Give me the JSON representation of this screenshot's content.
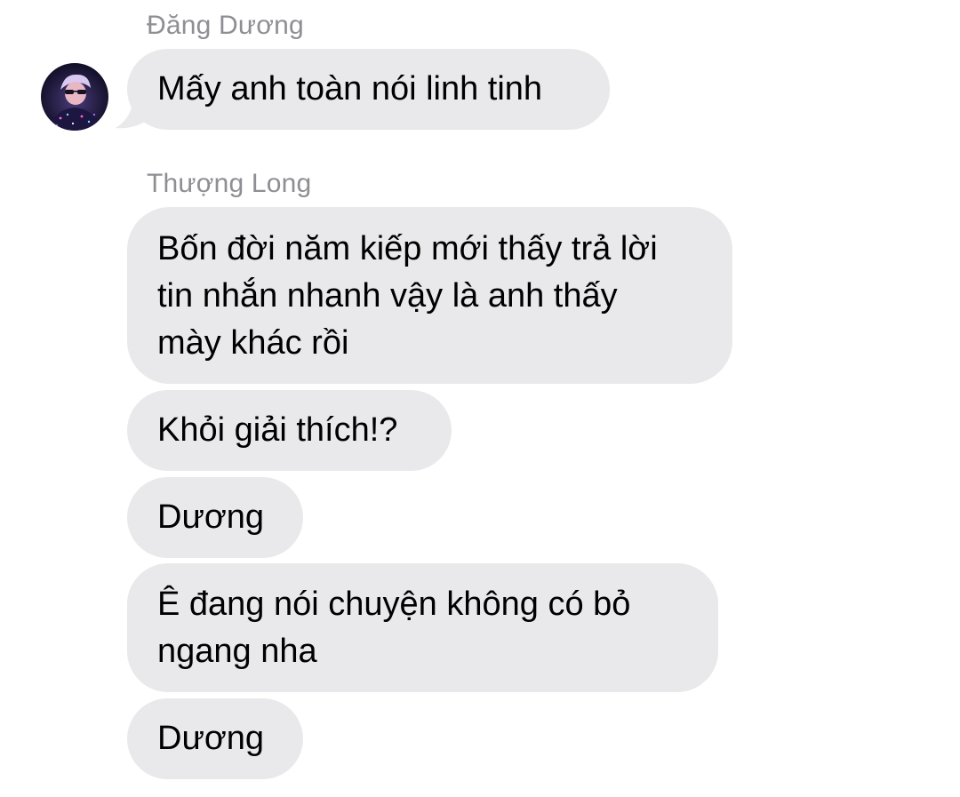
{
  "conversation": {
    "groups": [
      {
        "sender": "Đăng Dương",
        "messages": [
          {
            "lines": [
              "Mấy anh toàn nói linh tinh"
            ]
          }
        ]
      },
      {
        "sender": "Thượng Long",
        "messages": [
          {
            "lines": [
              "Bốn đời năm kiếp mới thấy trả lời",
              "tin nhắn nhanh vậy là anh thấy",
              "mày khác rồi"
            ]
          },
          {
            "lines": [
              "Khỏi giải thích!?"
            ]
          },
          {
            "lines": [
              "Dương"
            ]
          },
          {
            "lines": [
              "Ê đang nói chuyện không có bỏ",
              "ngang nha"
            ]
          },
          {
            "lines": [
              "Dương"
            ]
          }
        ]
      }
    ]
  },
  "colors": {
    "bubble_incoming": "#e9e9eb",
    "sender_name": "#8e8e93",
    "background": "#ffffff"
  },
  "icons": {
    "avatar": "user-avatar-icon"
  }
}
